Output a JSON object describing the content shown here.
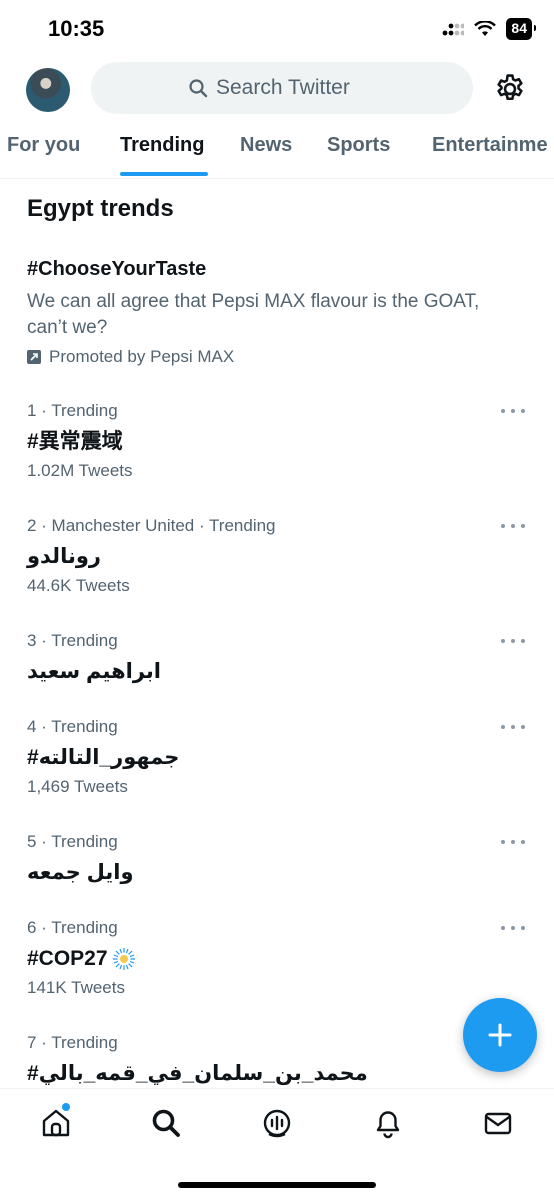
{
  "status": {
    "time": "10:35",
    "battery": "84"
  },
  "header": {
    "search_placeholder": "Search Twitter"
  },
  "tabs": [
    {
      "label": "For you"
    },
    {
      "label": "Trending"
    },
    {
      "label": "News"
    },
    {
      "label": "Sports"
    },
    {
      "label": "Entertainme"
    }
  ],
  "section_title": "Egypt trends",
  "promoted": {
    "tag": "#ChooseYourTaste",
    "description": "We can all agree that Pepsi MAX flavour is the GOAT, can’t we?",
    "promoted_by": "Promoted by Pepsi MAX"
  },
  "trends": [
    {
      "meta": "1 · Trending",
      "name": "#異常震域",
      "count": "1.02M Tweets"
    },
    {
      "meta": "2 · Manchester United · Trending",
      "name": "رونالدو",
      "count": "44.6K Tweets"
    },
    {
      "meta": "3 · Trending",
      "name": "ابراهيم سعيد",
      "count": ""
    },
    {
      "meta": "4 · Trending",
      "name": "#جمهور_التالته",
      "count": "1,469 Tweets"
    },
    {
      "meta": "5 · Trending",
      "name": "وايل جمعه",
      "count": ""
    },
    {
      "meta": "6 · Trending",
      "name": "#COP27",
      "count": "141K Tweets"
    },
    {
      "meta": "7 · Trending",
      "name": "#محمد_بن_سلمان_في_قمه_بالي",
      "count": ""
    }
  ],
  "icons": {
    "settings": "gear-icon",
    "compose": "plus-icon",
    "nav": [
      "home-icon",
      "search-icon",
      "spaces-icon",
      "bell-icon",
      "mail-icon"
    ]
  },
  "colors": {
    "accent": "#1d9bf0",
    "text": "#0f1419",
    "muted": "#536471"
  }
}
